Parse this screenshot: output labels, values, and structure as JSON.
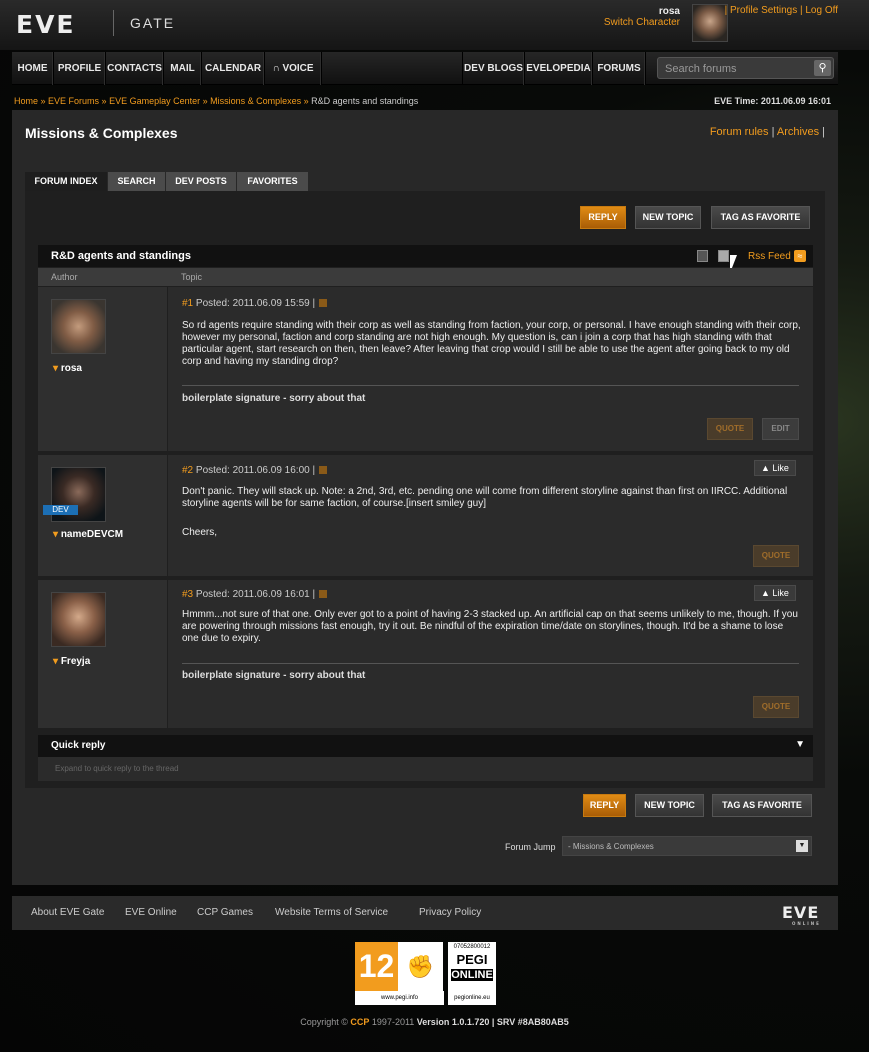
{
  "header": {
    "logo": "EVE",
    "product": "GATE",
    "username": "rosa",
    "switch_character": "Switch Character",
    "profile_settings": "Profile Settings",
    "sep": " | ",
    "log_off": "Log Off"
  },
  "nav": {
    "items": [
      "HOME",
      "PROFILE",
      "CONTACTS",
      "MAIL",
      "CALENDAR",
      "VOICE"
    ],
    "right_items": [
      "DEV BLOGS",
      "EVELOPEDIA",
      "FORUMS"
    ],
    "search_placeholder": "Search forums"
  },
  "breadcrumb": {
    "items": [
      "Home",
      "EVE Forums",
      "EVE Gameplay Center",
      "Missions & Complexes"
    ],
    "separator": " » ",
    "current": "R&D agents and standings"
  },
  "eve_time": "EVE Time: 2011.06.09 16:01",
  "page": {
    "title": "Missions & Complexes",
    "forum_rules": "Forum rules",
    "archives": "Archives",
    "sep": " | "
  },
  "tabs": [
    "FORUM INDEX",
    "SEARCH",
    "DEV POSTS",
    "FAVORITES"
  ],
  "actions": {
    "reply": "REPLY",
    "new_topic": "NEW TOPIC",
    "tag_favorite": "TAG AS FAVORITE"
  },
  "thread": {
    "title": "R&D agents and standings",
    "rss": "Rss Feed",
    "col_author": "Author",
    "col_topic": "Topic"
  },
  "posts": [
    {
      "num": "#1",
      "posted": " Posted: 2011.06.09 15:59  |",
      "author": "rosa",
      "body": "So rd agents require standing with their corp as well as standing from faction, your corp, or personal. I have enough standing with their corp, however my personal, faction and corp standing are not high enough. My question is, can i join a corp that has high standing with that particular agent, start research on then, then leave? After leaving that crop would I still be able to use the agent after going back to my old corp and having my standing drop?",
      "signature": "boilerplate signature - sorry about that",
      "quote": "QUOTE",
      "edit": "EDIT"
    },
    {
      "num": "#2",
      "posted": " Posted: 2011.06.09 16:00  |",
      "author": "nameDEVCM",
      "badge": "DEV",
      "like": "Like",
      "body": "Don't panic. They will stack up. Note: a 2nd, 3rd, etc. pending one will come from different storyline against than first on IIRCC. Additional storyline agents will be for same faction, of course.[insert smiley guy]",
      "body2": "Cheers,",
      "quote": "QUOTE"
    },
    {
      "num": "#3",
      "posted": " Posted: 2011.06.09 16:01  |",
      "author": "Freyja",
      "like": "Like",
      "body": "Hmmm...not sure of that one. Only ever got to a point of having 2-3 stacked up. An artificial cap on that seems unlikely to me, though. If you are powering through missions fast enough, try it out. Be nindful of the expiration time/date on storylines, though. It'd be a shame to lose one due to expiry.",
      "signature": "boilerplate signature - sorry about that",
      "quote": "QUOTE"
    }
  ],
  "quick_reply": {
    "title": "Quick reply",
    "hint": "Expand to quick reply to the thread"
  },
  "forum_jump": {
    "label": "Forum Jump",
    "selected": "- Missions & Complexes"
  },
  "footer": {
    "links": [
      "About EVE Gate",
      "EVE Online",
      "CCP Games",
      "Website Terms of Service",
      "Privacy Policy"
    ],
    "logo": "EVE",
    "logo_sub": "ONLINE"
  },
  "pegi": {
    "age": "12",
    "code": "07052800012",
    "pegi_label": "PEGI",
    "online_label": "ONLINE",
    "pegi_url": "www.pegi.info",
    "online_url": "pegionline.eu"
  },
  "copyright": {
    "prefix": "Copyright © ",
    "ccp": "CCP",
    "years": " 1997-2011 ",
    "version": "Version 1.0.1.720 | SRV #8AB80AB5"
  }
}
